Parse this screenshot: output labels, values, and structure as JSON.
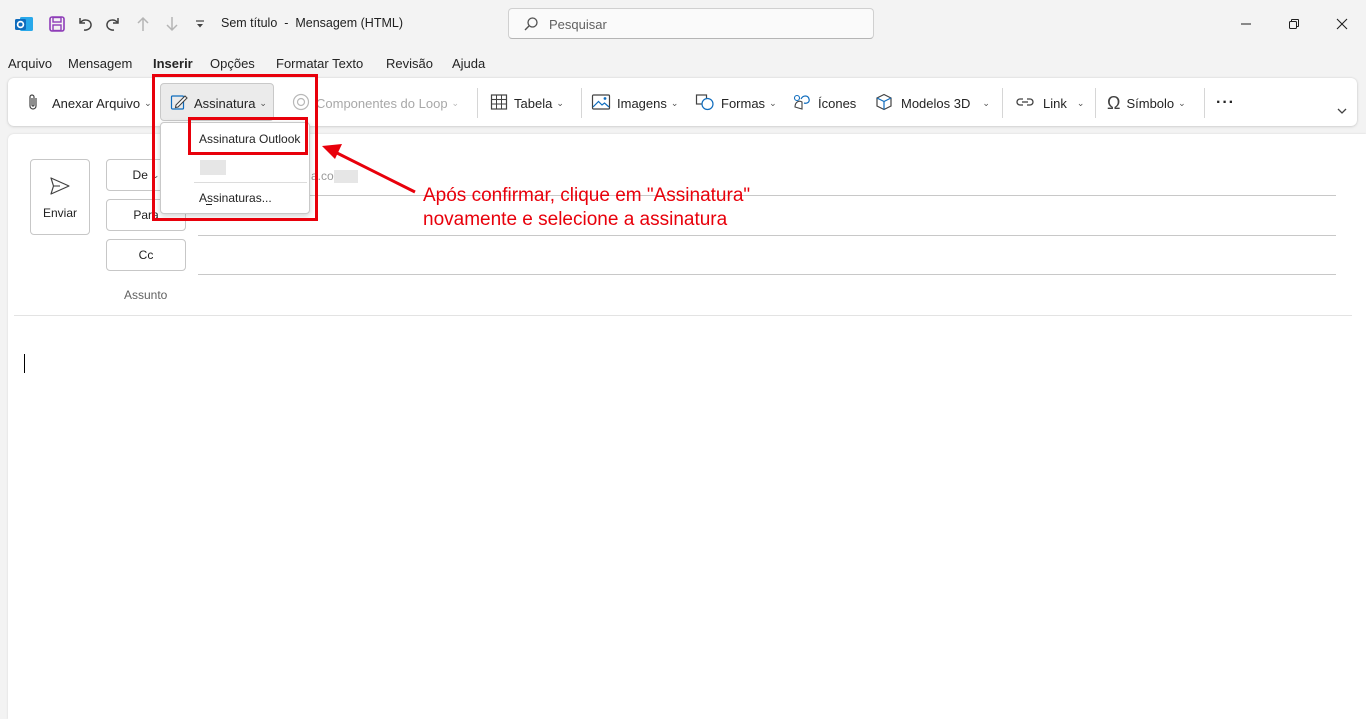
{
  "titlebar": {
    "title": "Sem título  -  Mensagem (HTML)",
    "search_placeholder": "Pesquisar"
  },
  "menu_tabs": [
    "Arquivo",
    "Mensagem",
    "Inserir",
    "Opções",
    "Formatar Texto",
    "Revisão",
    "Ajuda"
  ],
  "active_tab": "Inserir",
  "ribbon": {
    "attach": "Anexar Arquivo",
    "signature": "Assinatura",
    "loop": "Componentes do Loop",
    "table": "Tabela",
    "images": "Imagens",
    "shapes": "Formas",
    "icons": "Ícones",
    "models3d": "Modelos 3D",
    "link": "Link",
    "symbol": "Símbolo",
    "more": "···"
  },
  "compose": {
    "send": "Enviar",
    "from": "De",
    "to": "Para",
    "cc": "Cc",
    "subject": "Assunto",
    "from_value_partial": "a.co"
  },
  "signature_menu": {
    "items": [
      "Assinatura Outlook",
      "Assinaturas..."
    ],
    "access_key_letter": "s"
  },
  "annotation": {
    "line1": "Após confirmar, clique em \"Assinatura\"",
    "line2": "novamente e selecione a assinatura",
    "color": "#e8000b"
  },
  "colors": {
    "accent": "#0f6cbd",
    "outlook_blue": "#0f6cbd",
    "save_purple": "#8e3cb8",
    "annotation_red": "#e8000b"
  }
}
